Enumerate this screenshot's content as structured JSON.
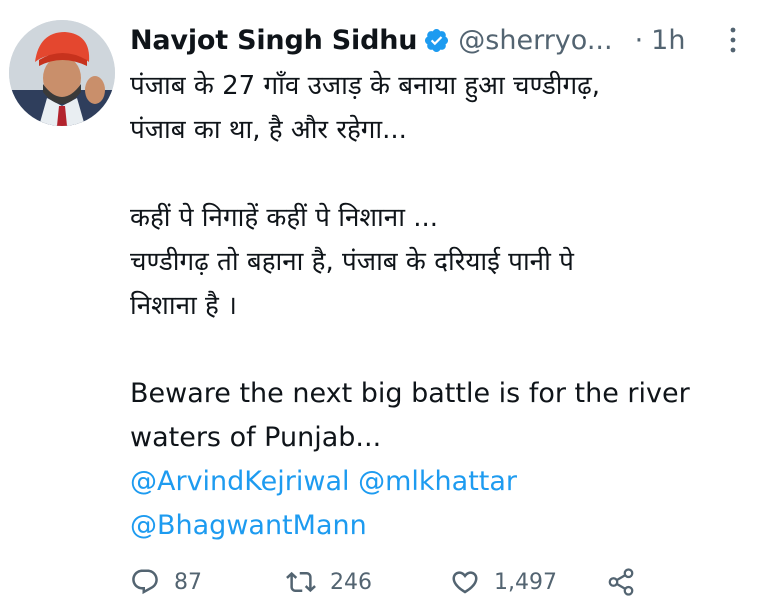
{
  "author": {
    "name": "Navjot Singh Sidhu",
    "handle": "@sherryo...",
    "separator": "·",
    "time": "1h"
  },
  "tweet": {
    "lines": [
      "पंजाब के 27 गाँव उजाड़ के बनाया हुआ चण्डीगढ़,",
      "पंजाब का था, है और रहेगा...",
      "कहीं पे निगाहें कहीं पे निशाना ...",
      "चण्डीगढ़ तो बहाना है, पंजाब के दरियाई पानी पे",
      "निशाना है ।",
      "Beware the next big battle is for the river",
      "waters of Punjab..."
    ],
    "mentions": [
      "@ArvindKejriwal",
      "@mlkhattar",
      "@BhagwantMann"
    ]
  },
  "actions": {
    "reply_count": "87",
    "retweet_count": "246",
    "like_count": "1,497"
  },
  "icons": {
    "verified": "verified-badge-icon",
    "more": "more-options-icon",
    "reply": "reply-icon",
    "retweet": "retweet-icon",
    "like": "heart-icon",
    "share": "share-icon"
  },
  "colors": {
    "text": "#0f1419",
    "secondary": "#536471",
    "link": "#1d9bf0",
    "verified": "#1d9bf0"
  }
}
